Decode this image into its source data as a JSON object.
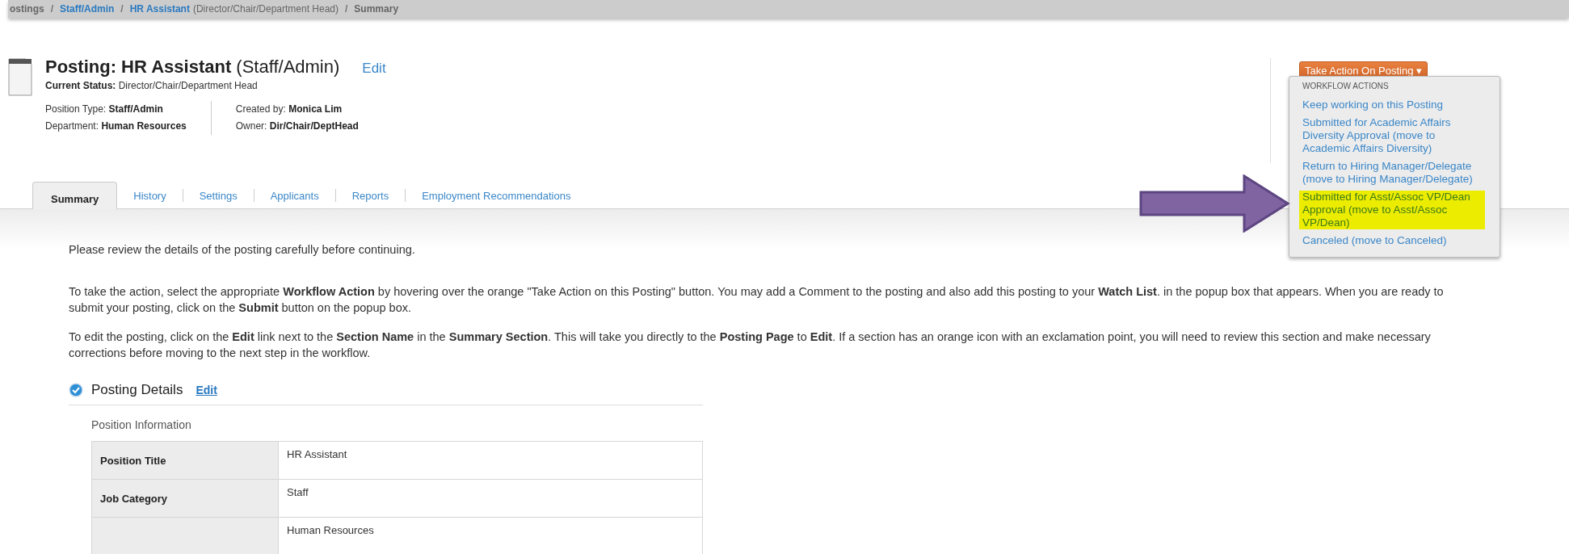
{
  "breadcrumb": [
    {
      "text": "ostings",
      "kind": "plain"
    },
    {
      "text": "Staff/Admin",
      "kind": "link",
      "separator": "/"
    },
    {
      "text": "HR Assistant",
      "kind": "link",
      "separator": "/",
      "suffix": "(Director/Chair/Department Head)"
    },
    {
      "text": "Summary",
      "kind": "plain",
      "separator": "/"
    }
  ],
  "header": {
    "title": "Posting: HR Assistant",
    "subtitle": "(Staff/Admin)",
    "edit": "Edit",
    "status_label": "Current Status:",
    "status": "Director/Chair/Department Head",
    "meta_left": [
      {
        "label": "Position Type:",
        "value": "Staff/Admin"
      },
      {
        "label": "Department:",
        "value": "Human Resources"
      }
    ],
    "meta_right": [
      {
        "label": "Created by:",
        "value": "Monica Lim"
      },
      {
        "label": "Owner:",
        "value": "Dir/Chair/DeptHead"
      }
    ]
  },
  "action_button": {
    "label": "Take Action On Posting",
    "caret": "▾"
  },
  "action_menu": {
    "heading": "WORKFLOW ACTIONS",
    "items": [
      {
        "label": "Keep working on this Posting",
        "highlighted": false
      },
      {
        "label": "Submitted for Academic Affairs Diversity Approval (move to Academic Affairs Diversity)",
        "highlighted": false
      },
      {
        "label": "Return to Hiring Manager/Delegate (move to Hiring Manager/Delegate)",
        "highlighted": false
      },
      {
        "label": "Submitted for Asst/Assoc VP/Dean Approval (move to Asst/Assoc VP/Dean)",
        "highlighted": true
      },
      {
        "label": "Canceled (move to Canceled)",
        "highlighted": false
      }
    ]
  },
  "tabs": [
    {
      "label": "Summary",
      "selected": true
    },
    {
      "label": "History",
      "selected": false
    },
    {
      "label": "Settings",
      "selected": false
    },
    {
      "label": "Applicants",
      "selected": false
    },
    {
      "label": "Reports",
      "selected": false
    },
    {
      "label": "Employment Recommendations",
      "selected": false
    }
  ],
  "intro": "Please review the details of the posting carefully before continuing.",
  "paragraphs": [
    "To take the action, select the appropriate **Workflow Action** by hovering over the orange \"Take Action on this Posting\" button. You may add a Comment to the posting and also add this posting to your **Watch List**. in the popup box that appears. When you are ready to submit your posting, click on the **Submit** button on the popup box.",
    "To edit the posting, click on the **Edit** link next to the **Section Name** in the **Summary Section**. This will take you directly to the **Posting Page** to **Edit**. If a section has an orange icon with an exclamation point, you will need to review this section and make necessary corrections before moving to the next step in the workflow."
  ],
  "section": {
    "title": "Posting Details",
    "edit": "Edit",
    "complete": true,
    "subheading": "Position Information",
    "rows": [
      {
        "label": "Position Title",
        "value": "HR Assistant"
      },
      {
        "label": "Job Category",
        "value": "Staff"
      },
      {
        "value": "Human Resources"
      }
    ]
  }
}
